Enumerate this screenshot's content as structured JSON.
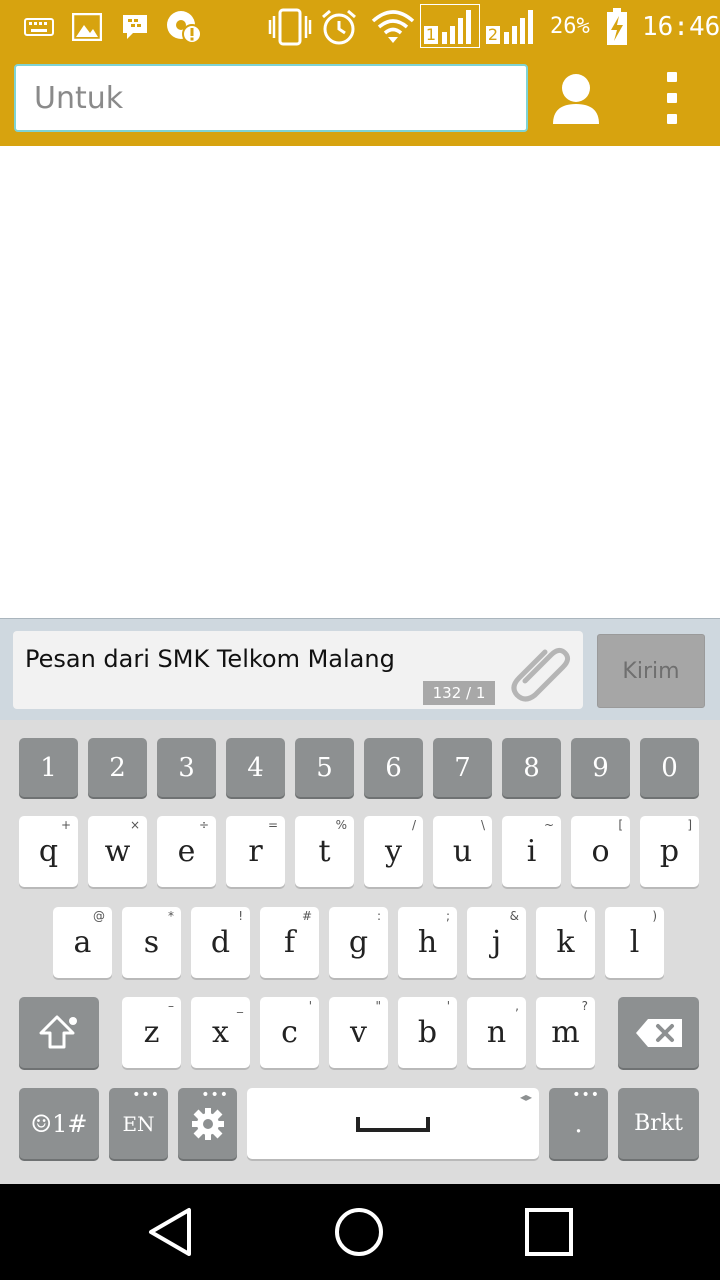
{
  "status_bar": {
    "battery_percent": "26%",
    "time": "16:46",
    "sim1_label": "1",
    "sim2_label": "2",
    "icons": [
      "keyboard-icon",
      "image-icon",
      "bbm-icon",
      "alert-icon",
      "vibrate-icon",
      "alarm-icon",
      "wifi-icon",
      "signal-sim1-icon",
      "signal-sim2-icon",
      "battery-charging-icon"
    ]
  },
  "header": {
    "to_placeholder": "Untuk",
    "to_value": "",
    "contact_icon": "contact-icon",
    "menu_icon": "more-vert-icon"
  },
  "compose": {
    "message": "Pesan dari SMK Telkom Malang",
    "counter": "132 / 1",
    "attach_icon": "paperclip-icon",
    "send_label": "Kirim"
  },
  "keyboard": {
    "number_row": [
      "1",
      "2",
      "3",
      "4",
      "5",
      "6",
      "7",
      "8",
      "9",
      "0"
    ],
    "row1": [
      {
        "k": "q",
        "s": "+"
      },
      {
        "k": "w",
        "s": "×"
      },
      {
        "k": "e",
        "s": "÷"
      },
      {
        "k": "r",
        "s": "="
      },
      {
        "k": "t",
        "s": "%"
      },
      {
        "k": "y",
        "s": "/"
      },
      {
        "k": "u",
        "s": "\\"
      },
      {
        "k": "i",
        "s": "~"
      },
      {
        "k": "o",
        "s": "["
      },
      {
        "k": "p",
        "s": "]"
      }
    ],
    "row2": [
      {
        "k": "a",
        "s": "@"
      },
      {
        "k": "s",
        "s": "*"
      },
      {
        "k": "d",
        "s": "!"
      },
      {
        "k": "f",
        "s": "#"
      },
      {
        "k": "g",
        "s": ":"
      },
      {
        "k": "h",
        "s": ";"
      },
      {
        "k": "j",
        "s": "&"
      },
      {
        "k": "k",
        "s": "("
      },
      {
        "k": "l",
        "s": ")"
      }
    ],
    "row3": [
      {
        "k": "z",
        "s": "–"
      },
      {
        "k": "x",
        "s": "_"
      },
      {
        "k": "c",
        "s": "'"
      },
      {
        "k": "v",
        "s": "\""
      },
      {
        "k": "b",
        "s": "'"
      },
      {
        "k": "n",
        "s": ","
      },
      {
        "k": "m",
        "s": "?"
      }
    ],
    "emoji_label": "☺1#",
    "lang_label": "EN",
    "period_label": ".",
    "enter_label": "Brkt",
    "more_dots": "•••",
    "space_arrows": "◂▸"
  },
  "colors": {
    "accent": "#d7a30f",
    "field_border": "#7fd3d3",
    "key_dark": "#8d9091",
    "key_light": "#ffffff",
    "keyboard_bg": "#dcdcdc"
  }
}
